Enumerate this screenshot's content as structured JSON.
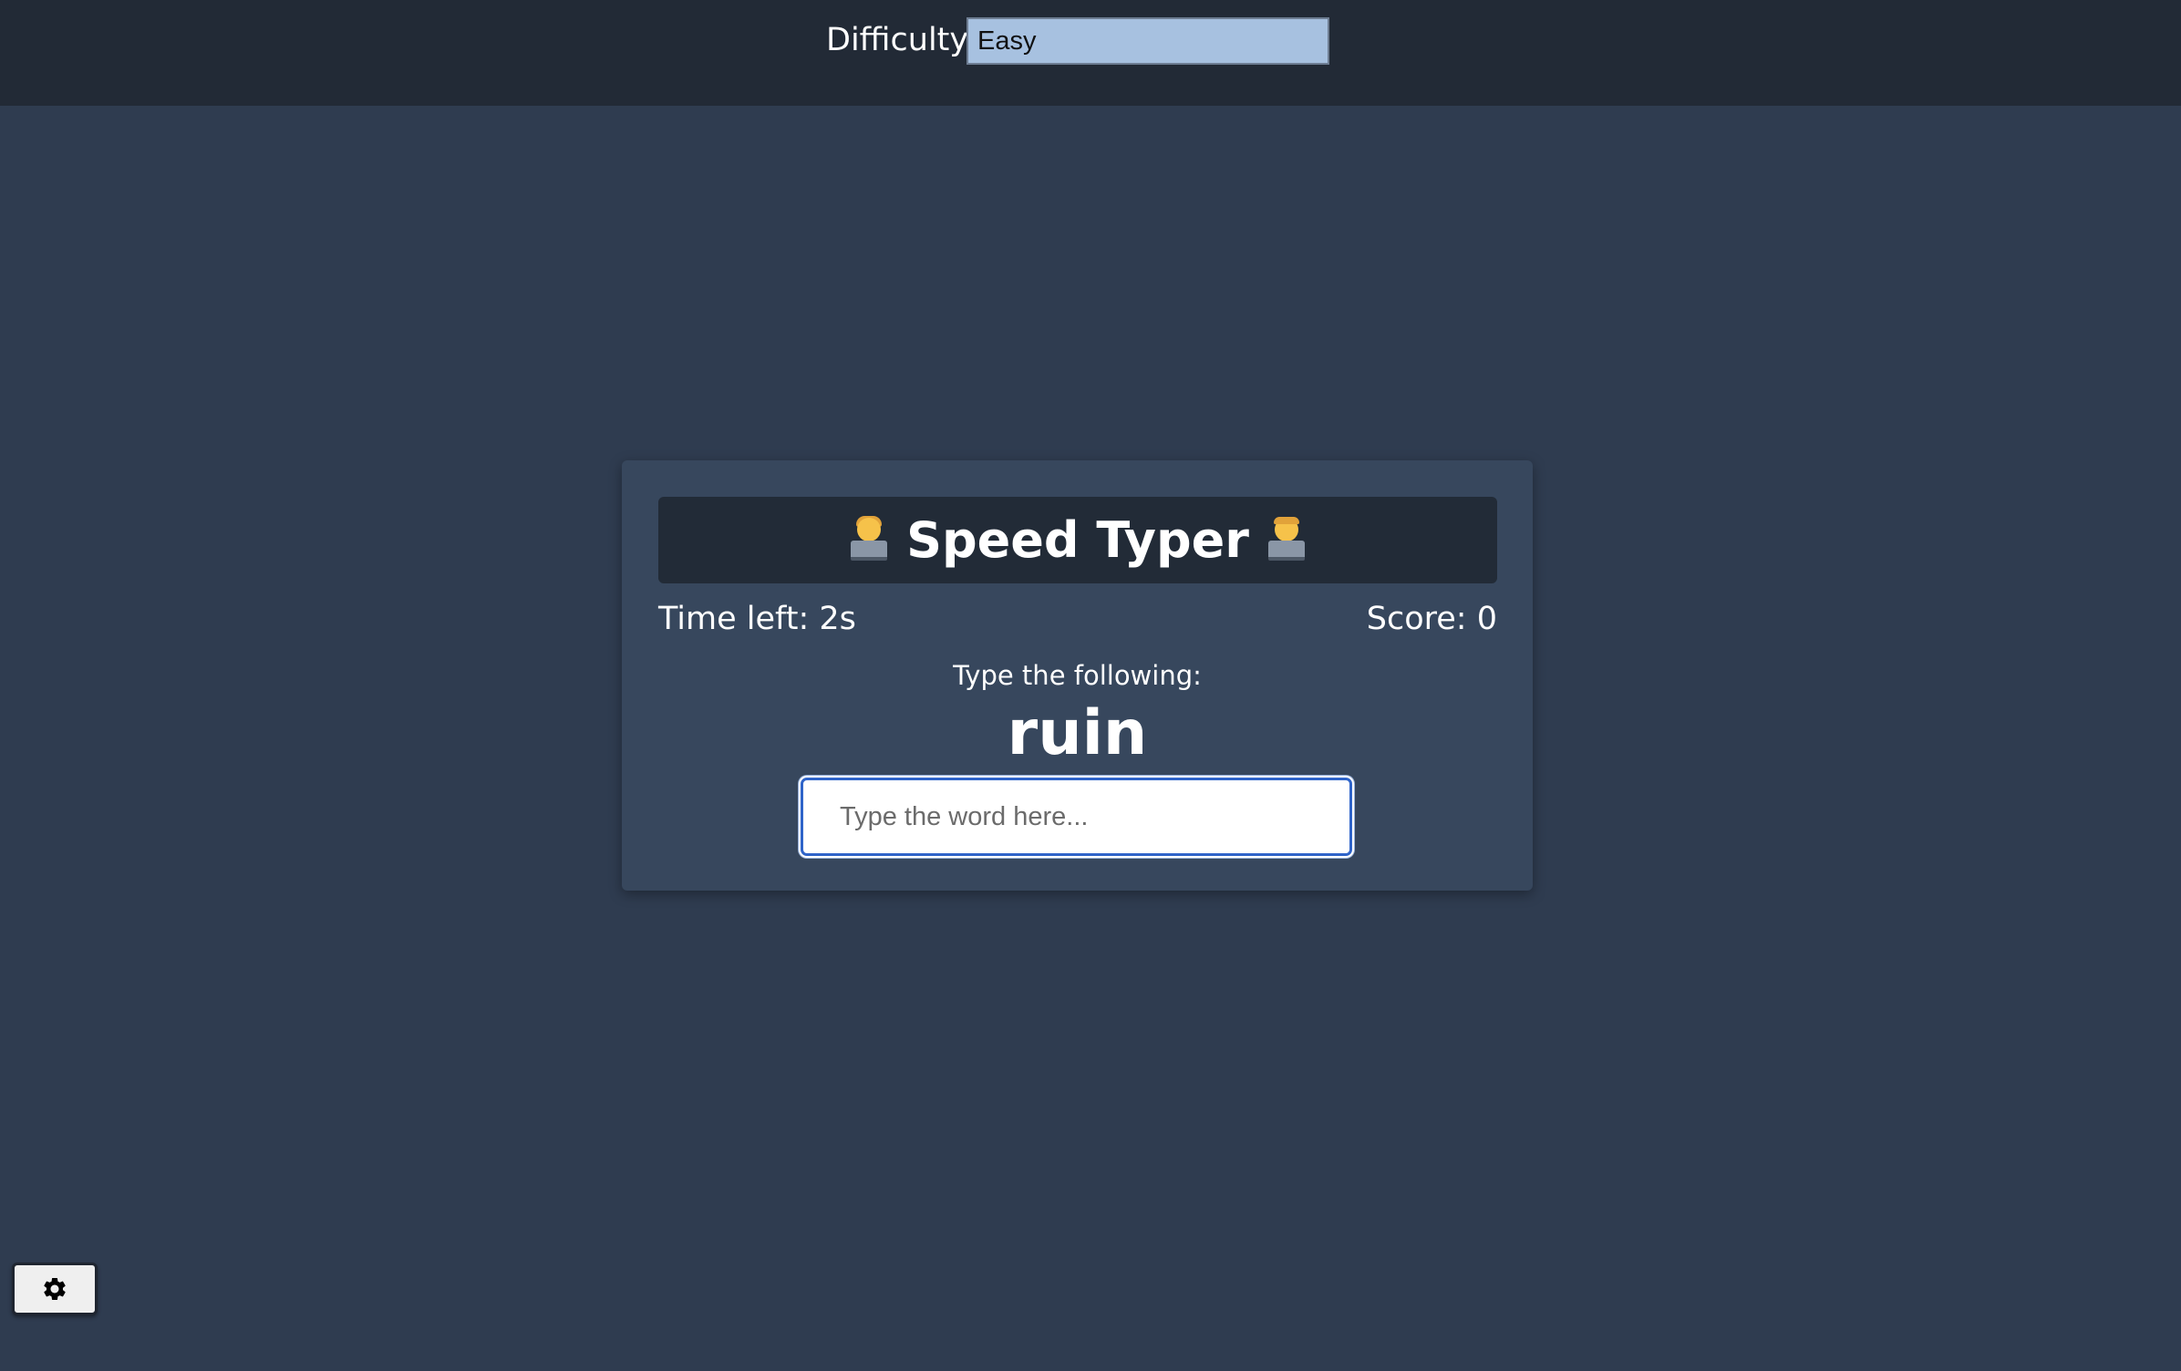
{
  "settings": {
    "difficulty_label": "Difficulty",
    "difficulty_value": "Easy"
  },
  "game": {
    "title": "Speed Typer",
    "title_icon_left": "person-technologist-emoji",
    "title_icon_right": "man-technologist-emoji",
    "time_left": "Time left: 2s",
    "score": "Score: 0",
    "prompt_label": "Type the following:",
    "target_word": "ruin",
    "input_placeholder": "Type the word here...",
    "input_value": ""
  },
  "settings_toggle": {
    "icon": "gear-icon"
  },
  "colors": {
    "background": "#2f3c50",
    "settings_bar": "#222a36",
    "card": "#37475d",
    "title_box": "#222b37",
    "select_bg": "#a7c1e0",
    "input_focus": "#2f64c9"
  }
}
